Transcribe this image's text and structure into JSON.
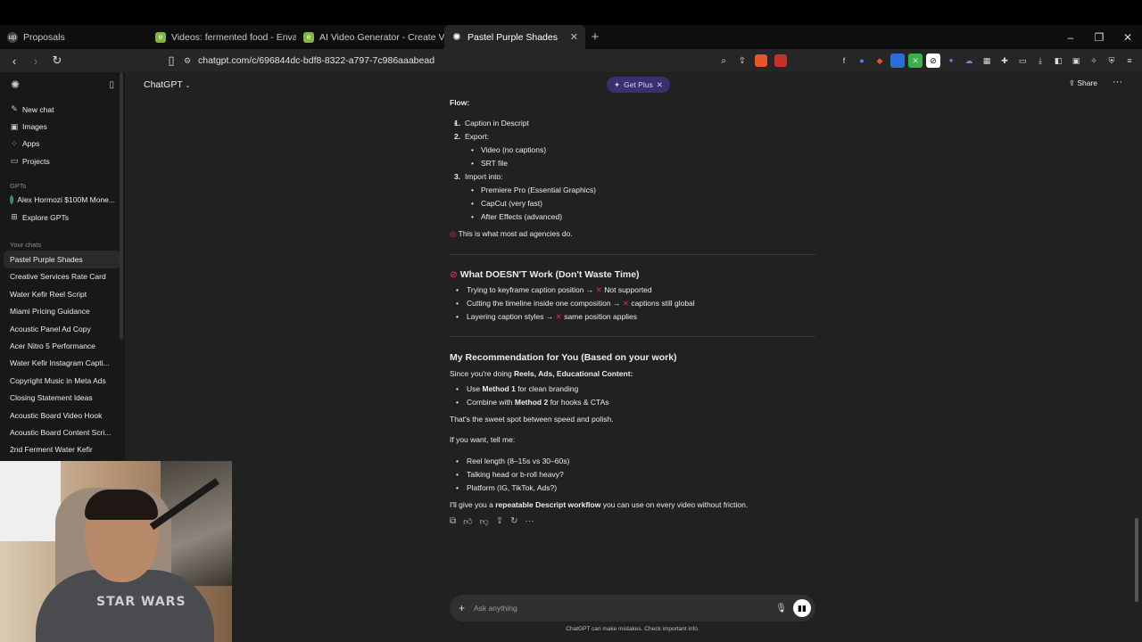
{
  "browser": {
    "tabs": [
      {
        "title": "Proposals",
        "icon": "upwork-icon"
      },
      {
        "title": "Videos: fermented food - Envato",
        "icon": "envato-icon"
      },
      {
        "title": "AI Video Generator - Create Videos fr",
        "icon": "envato-icon"
      },
      {
        "title": "Pastel Purple Shades",
        "icon": "chatgpt-icon",
        "active": true
      }
    ],
    "url": "chatgpt.com/c/696844dc-bdf8-8322-a797-7c986aaabead"
  },
  "sidebar": {
    "nav": [
      {
        "label": "New chat",
        "icon": "compose-icon"
      },
      {
        "label": "Images",
        "icon": "image-icon"
      },
      {
        "label": "Apps",
        "icon": "apps-icon"
      },
      {
        "label": "Projects",
        "icon": "folder-icon"
      }
    ],
    "gpts_heading": "GPTs",
    "gpts": [
      {
        "label": "Alex Hormozi $100M Mone..."
      },
      {
        "label": "Explore GPTs"
      }
    ],
    "chats_heading": "Your chats",
    "chats": [
      "Pastel Purple Shades",
      "Creative Services Rate Card",
      "Water Kefir Reel Script",
      "Miami Pricing Guidance",
      "Acoustic Panel Ad Copy",
      "Acer Nitro 5 Performance",
      "Water Kefir Instagram Capti...",
      "Copyright Music in Meta Ads",
      "Closing Statement Ideas",
      "Acoustic Board Video Hook",
      "Acoustic Board Content Scri...",
      "2nd Ferment Water Kefir"
    ]
  },
  "header": {
    "model": "ChatGPT",
    "get_plus": "Get Plus",
    "share": "Share"
  },
  "message": {
    "flow_label": "Flow:",
    "steps": [
      {
        "num": "1.",
        "text": "Caption in Descript"
      },
      {
        "num": "2.",
        "text": "Export:",
        "sub": [
          "Video (no captions)",
          "SRT file"
        ]
      },
      {
        "num": "3.",
        "text": "Import into:",
        "sub": [
          "Premiere Pro (Essential Graphics)",
          "CapCut (very fast)",
          "After Effects (advanced)"
        ]
      }
    ],
    "agency_note": "This is what most ad agencies do.",
    "doesnt_work_heading": "What DOESN'T Work (Don't Waste Time)",
    "doesnt_work": [
      {
        "pre": "Trying to keyframe caption position →",
        "post": "Not supported"
      },
      {
        "pre": "Cutting the timeline inside one composition →",
        "post": "captions still global"
      },
      {
        "pre": "Layering caption styles →",
        "post": "same position applies"
      }
    ],
    "rec_heading": "My Recommendation for You (Based on your work)",
    "rec_intro_pre": "Since you're doing",
    "rec_intro_bold": "Reels, Ads, Educational Content:",
    "rec_items": [
      {
        "pre": "Use",
        "bold": "Method 1",
        "post": "for clean branding"
      },
      {
        "pre": "Combine with",
        "bold": "Method 2",
        "post": "for hooks & CTAs"
      }
    ],
    "sweet_spot": "That's the sweet spot between speed and polish.",
    "tell_me": "If you want, tell me:",
    "questions": [
      "Reel length (8–15s vs 30–60s)",
      "Talking head or b-roll heavy?",
      "Platform (IG, TikTok, Ads?)"
    ],
    "closing_pre": "I'll give you a",
    "closing_bold": "repeatable Descript workflow",
    "closing_post": "you can use on every video without friction."
  },
  "composer": {
    "placeholder": "Ask anything",
    "disclaimer": "ChatGPT can make mistakes. Check important info."
  },
  "webcam": {
    "shirt_text": "STAR WARS"
  }
}
